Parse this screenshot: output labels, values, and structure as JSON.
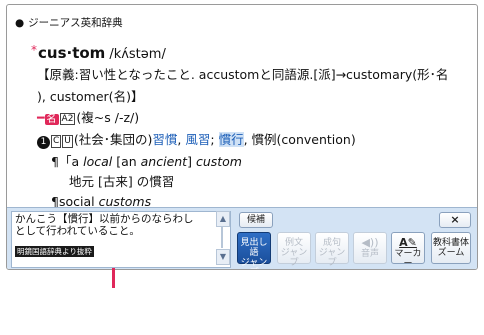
{
  "dictionary": {
    "name": "ジーニアス英和辞典"
  },
  "entry": {
    "star": "*",
    "headword": "cus·tom",
    "pronunciation": "/kʌ́stəm/",
    "etymology_line1": "【原義:習い性となったこと. accustomと同語源.[派]→customary(形･名",
    "etymology_line2": "), customer(名)】",
    "noun_marker": "名",
    "noun_dash": "━",
    "noun_box": "A2",
    "noun_plural": "(複~s /-z/)",
    "sense_number": "1",
    "sense_box_c": "C",
    "sense_box_u": "U",
    "sense_label": "(社会･集団の)",
    "sense_def1": "習慣",
    "sense_sep1": ", ",
    "sense_def2": "風習",
    "sense_sep2": "; ",
    "sense_def3": "慣行",
    "sense_rest": ", 慣例(convention)",
    "example1_prefix": "¶「a ",
    "example1_local": "local",
    "example1_mid": " [an ",
    "example1_ancient": "ancient",
    "example1_end": "] ",
    "example1_custom": "custom",
    "example2": "地元 [古来] の慣習",
    "example3_prefix": "¶social ",
    "example3_word": "customs"
  },
  "panel": {
    "definition_line1": "かんこう【慣行】以前からのならわし",
    "definition_line2": "として行われていること。",
    "source_badge": "明鏡国語辞典より抜粋",
    "scroll_up": "▲",
    "scroll_down": "▼",
    "buttons": {
      "candidate": "候補",
      "midashi_line1": "見出し語",
      "midashi_line2": "ジャンプ",
      "example_line1": "例文",
      "example_line2": "ジャンプ",
      "phrase_line1": "成句",
      "phrase_line2": "ジャンプ",
      "audio_icon": "◀))",
      "audio_label": "音声",
      "marker_icon": "A✎",
      "marker_label": "マーカー",
      "close": "×",
      "zoom_line1": "教科書体",
      "zoom_line2": "ズーム"
    }
  },
  "colors": {
    "accent": "#e0285a",
    "link_blue": "#1d5fb8",
    "panel_bg": "#d3e3f4",
    "primary_button": "#1b4f9c"
  }
}
